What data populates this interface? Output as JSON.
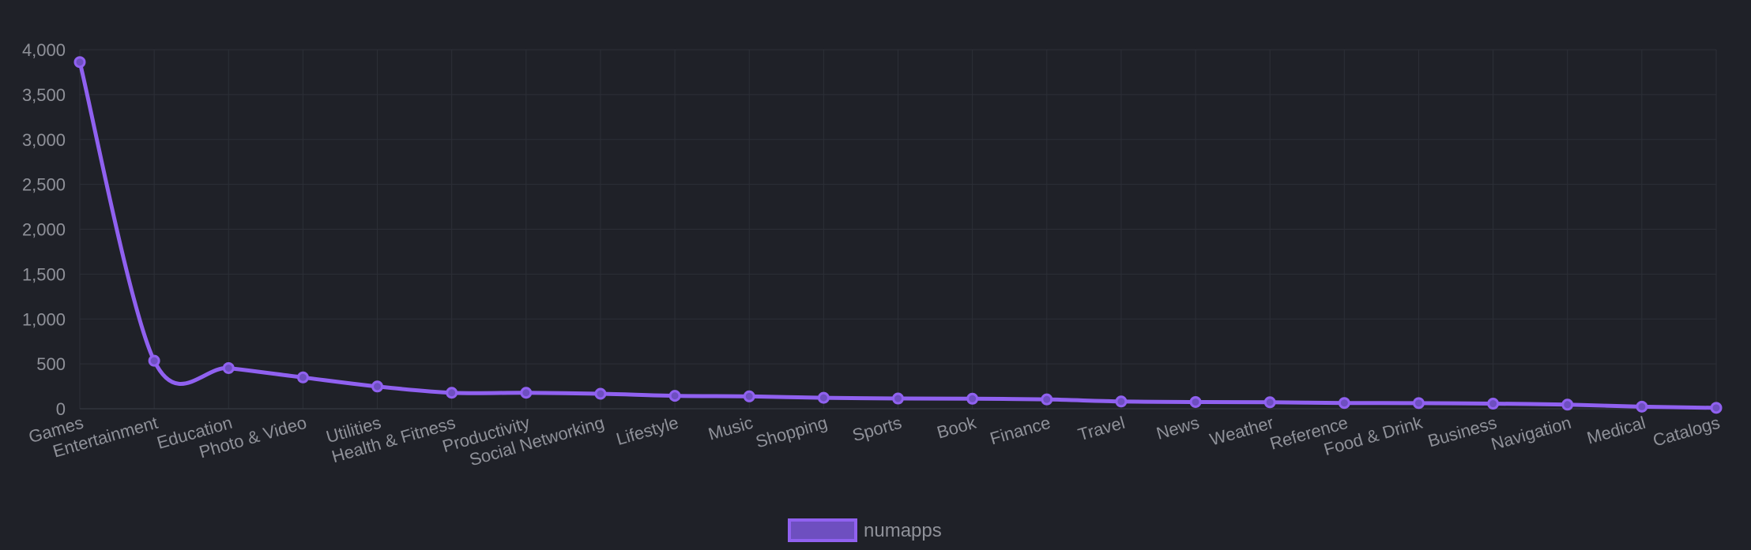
{
  "colors": {
    "background": "#1f2128",
    "series": "#9061f0",
    "series_fill": "#6e4fc0",
    "grid": "#2c2f37",
    "text": "#8f9199"
  },
  "chart_data": {
    "type": "line",
    "categories": [
      "Games",
      "Entertainment",
      "Education",
      "Photo & Video",
      "Utilities",
      "Health & Fitness",
      "Productivity",
      "Social Networking",
      "Lifestyle",
      "Music",
      "Shopping",
      "Sports",
      "Book",
      "Finance",
      "Travel",
      "News",
      "Weather",
      "Reference",
      "Food & Drink",
      "Business",
      "Navigation",
      "Medical",
      "Catalogs"
    ],
    "series": [
      {
        "name": "numapps",
        "values": [
          3862,
          535,
          453,
          349,
          248,
          178,
          178,
          167,
          144,
          138,
          122,
          114,
          112,
          104,
          81,
          75,
          72,
          64,
          63,
          57,
          46,
          23,
          10
        ]
      }
    ],
    "y_ticks": [
      "0",
      "500",
      "1,000",
      "1,500",
      "2,000",
      "2,500",
      "3,000",
      "3,500",
      "4,000"
    ],
    "ylim": [
      0,
      4000
    ],
    "grid": true,
    "legend_position": "bottom"
  }
}
